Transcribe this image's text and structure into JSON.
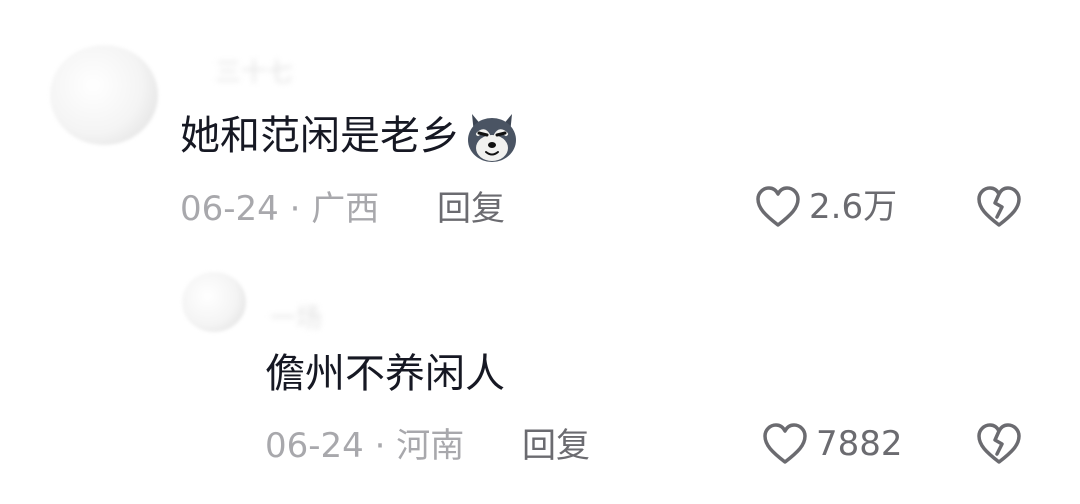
{
  "comments": [
    {
      "username": "三十七",
      "text": "她和范闲是老乡",
      "emoji": "husky-dog-emoji",
      "date": "06-24",
      "separator": "·",
      "location": "广西",
      "reply_label": "回复",
      "likes": "2.6万"
    },
    {
      "username": "一场",
      "text": "儋州不养闲人",
      "date": "06-24",
      "separator": "·",
      "location": "河南",
      "reply_label": "回复",
      "likes": "7882"
    }
  ],
  "icons": {
    "like": "heart-outline-icon",
    "dislike": "broken-heart-icon"
  },
  "colors": {
    "text": "#161823",
    "meta": "#a8a8ac",
    "action": "#6b6b70"
  }
}
